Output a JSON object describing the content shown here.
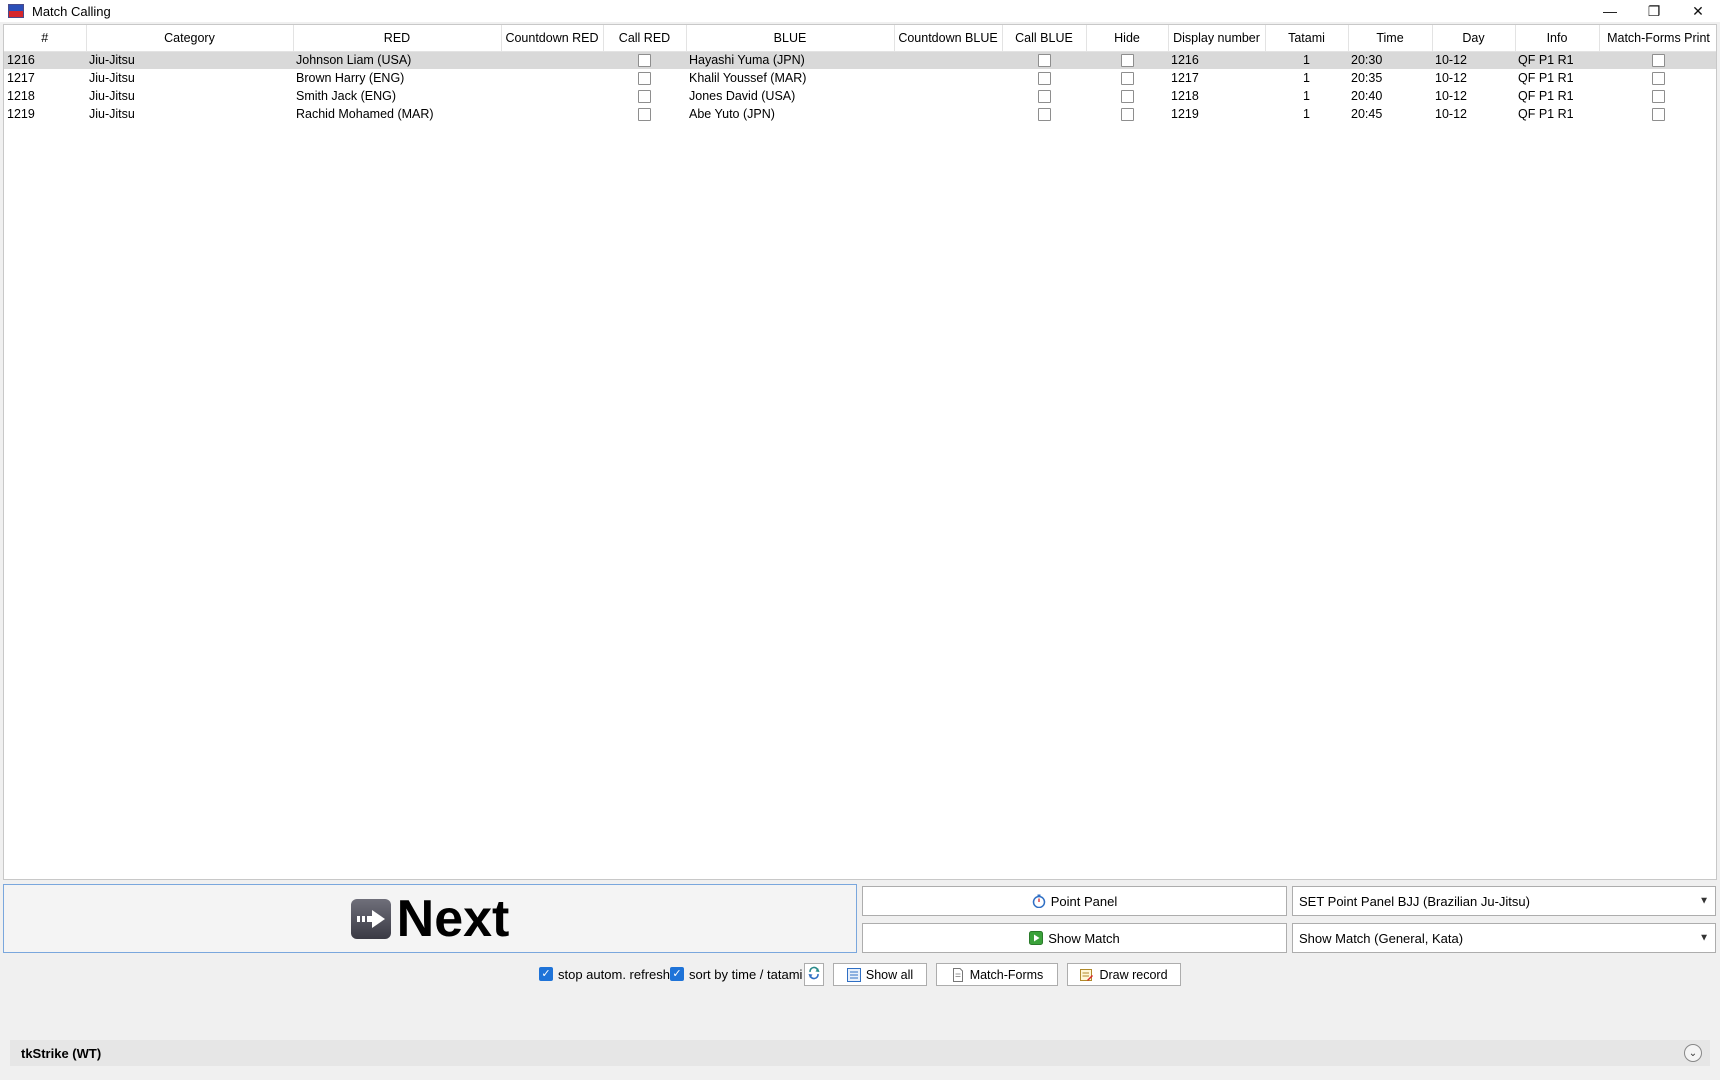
{
  "window": {
    "title": "Match Calling",
    "minimize": "—",
    "restore": "❐",
    "close": "✕"
  },
  "table": {
    "columns": [
      "#",
      "Category",
      "RED",
      "Countdown RED",
      "Call RED",
      "BLUE",
      "Countdown BLUE",
      "Call BLUE",
      "Hide",
      "Display number",
      "Tatami",
      "Time",
      "Day",
      "Info",
      "Match-Forms Print"
    ],
    "rows": [
      {
        "num": "1216",
        "category": "Jiu-Jitsu",
        "red": "Johnson Liam (USA)",
        "countdown_red": "",
        "blue": "Hayashi Yuma (JPN)",
        "countdown_blue": "",
        "display": "1216",
        "tatami": "1",
        "time": "20:30",
        "day": "10-12",
        "info": "QF P1 R1"
      },
      {
        "num": "1217",
        "category": "Jiu-Jitsu",
        "red": "Brown Harry (ENG)",
        "countdown_red": "",
        "blue": "Khalil Youssef (MAR)",
        "countdown_blue": "",
        "display": "1217",
        "tatami": "1",
        "time": "20:35",
        "day": "10-12",
        "info": "QF P1 R1"
      },
      {
        "num": "1218",
        "category": "Jiu-Jitsu",
        "red": "Smith Jack (ENG)",
        "countdown_red": "",
        "blue": "Jones David (USA)",
        "countdown_blue": "",
        "display": "1218",
        "tatami": "1",
        "time": "20:40",
        "day": "10-12",
        "info": "QF P1 R1"
      },
      {
        "num": "1219",
        "category": "Jiu-Jitsu",
        "red": "Rachid Mohamed (MAR)",
        "countdown_red": "",
        "blue": "Abe Yuto (JPN)",
        "countdown_blue": "",
        "display": "1219",
        "tatami": "1",
        "time": "20:45",
        "day": "10-12",
        "info": "QF P1 R1"
      }
    ]
  },
  "controls": {
    "next_label": "Next",
    "point_panel_label": "Point Panel",
    "show_match_label": "Show Match",
    "point_panel_select": "SET Point Panel BJJ (Brazilian Ju-Jitsu)",
    "show_match_select": "Show Match (General, Kata)",
    "stop_refresh_label": "stop autom. refresh",
    "sort_label": "sort by time / tatami",
    "show_all_label": "Show all",
    "match_forms_label": "Match-Forms",
    "draw_record_label": "Draw record"
  },
  "status": {
    "text": "tkStrike (WT)"
  },
  "colors": {
    "selected_row": "#d9d9d9",
    "checkbox_accent": "#1e73d8",
    "next_border": "#7aa7dd"
  }
}
